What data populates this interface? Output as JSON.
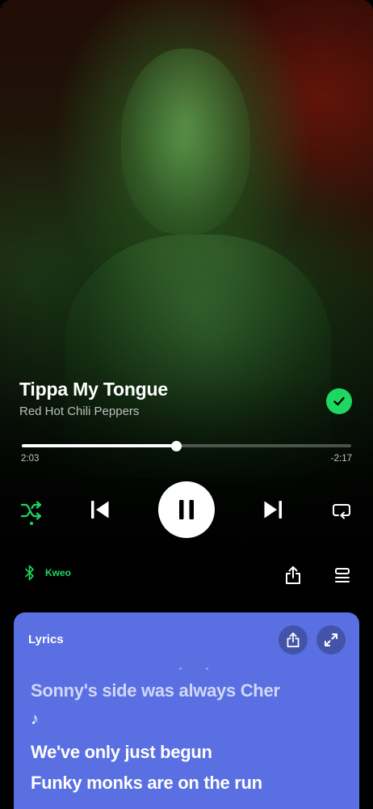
{
  "track": {
    "title": "Tippa My Tongue",
    "artist": "Red Hot Chili Peppers",
    "liked": true
  },
  "playback": {
    "elapsed": "2:03",
    "remaining": "-2:17",
    "progress_fraction": 0.47,
    "state": "playing",
    "shuffle_enabled": true,
    "repeat_enabled": false
  },
  "device": {
    "icon": "bluetooth-icon",
    "name": "Kweo"
  },
  "lyrics": {
    "header": "Lyrics",
    "lines": [
      "Sonny's side was always Cher",
      "♪",
      "We've only just begun",
      "Funky monks are on the run"
    ]
  },
  "colors": {
    "accent_green": "#1ed760",
    "lyrics_card": "#5a6fe1",
    "background": "#000000"
  }
}
